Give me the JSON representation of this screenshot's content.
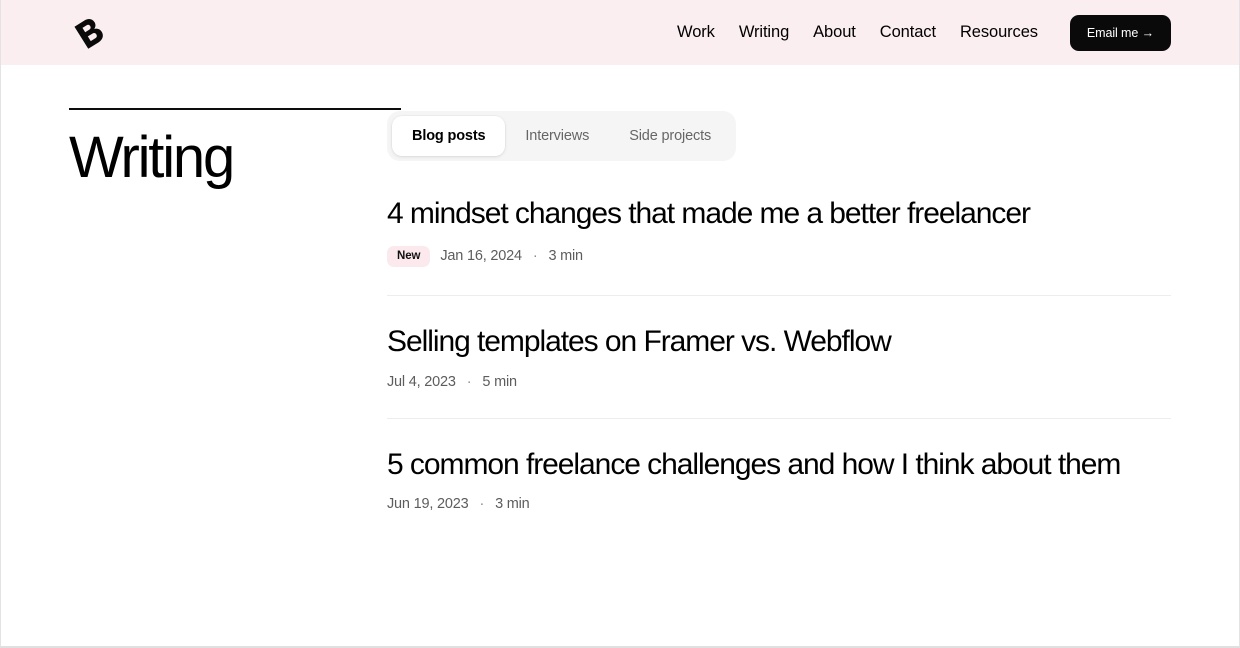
{
  "theme": {
    "header_bg": "#fbeef1",
    "page_bg": "#ffffff",
    "accent_badge_bg": "#fbe9ee",
    "button_bg": "#0a0a0a",
    "button_text": "#ffffff",
    "tabs_bg": "#f5f5f5",
    "divider": "#ededed",
    "meta_text": "#5d5d5d"
  },
  "header": {
    "logo_name": "brand-logo",
    "nav": [
      {
        "label": "Work"
      },
      {
        "label": "Writing"
      },
      {
        "label": "About"
      },
      {
        "label": "Contact"
      },
      {
        "label": "Resources"
      }
    ],
    "cta": {
      "label": "Email me →"
    }
  },
  "sidebar": {
    "page_title": "Writing"
  },
  "main": {
    "tabs": [
      {
        "label": "Blog posts",
        "active": true
      },
      {
        "label": "Interviews",
        "active": false
      },
      {
        "label": "Side projects",
        "active": false
      }
    ],
    "posts": [
      {
        "title": "4 mindset changes that made me a better freelancer",
        "badge": "New",
        "date": "Jan 16, 2024",
        "separator": "·",
        "read_time": "3 min"
      },
      {
        "title": "Selling templates on Framer vs. Webflow",
        "badge": null,
        "date": "Jul 4, 2023",
        "separator": "·",
        "read_time": "5 min"
      },
      {
        "title": "5 common freelance challenges and how I think about them",
        "badge": null,
        "date": "Jun 19, 2023",
        "separator": "·",
        "read_time": "3 min"
      }
    ]
  }
}
